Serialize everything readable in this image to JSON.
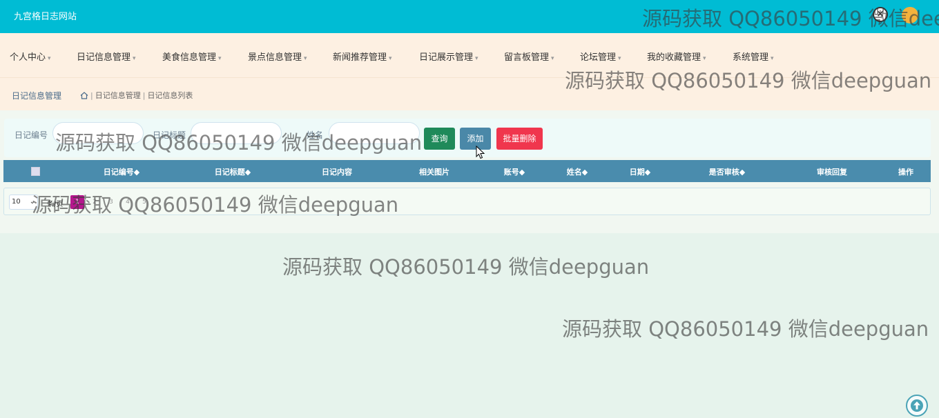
{
  "app": {
    "brand": "九宫格日志网站"
  },
  "nav": {
    "items": [
      {
        "label": "个人中心"
      },
      {
        "label": "日记信息管理"
      },
      {
        "label": "美食信息管理"
      },
      {
        "label": "景点信息管理"
      },
      {
        "label": "新闻推荐管理"
      },
      {
        "label": "日记展示管理"
      },
      {
        "label": "留言板管理"
      },
      {
        "label": "论坛管理"
      },
      {
        "label": "我的收藏管理"
      },
      {
        "label": "系统管理"
      }
    ]
  },
  "breadcrumb": {
    "title": "日记信息管理",
    "items": [
      "日记信息管理",
      "日记信息列表"
    ]
  },
  "search": {
    "fields": [
      {
        "label": "日记编号",
        "value": ""
      },
      {
        "label": "日记标题",
        "value": ""
      },
      {
        "label": "姓名",
        "value": ""
      }
    ],
    "search_label": "查询",
    "add_label": "添加",
    "delete_label": "批量删除"
  },
  "table": {
    "columns": [
      "日记编号◆",
      "日记标题◆",
      "日记内容",
      "相关图片",
      "账号◆",
      "姓名◆",
      "日期◆",
      "是否审核◆",
      "审核回复",
      "操作"
    ]
  },
  "pager": {
    "page_size": "10",
    "per_page_label": "条/页",
    "pages": [
      "1",
      "2",
      "3",
      "4",
      "5"
    ],
    "current_page": 1
  },
  "watermark": {
    "text": "源码获取 QQ86050149 微信deepguan"
  },
  "colors": {
    "topbar": "#00bcd4",
    "nav_bg": "#fdf0e2",
    "table_header": "#4a8cad",
    "search_btn": "#1f8a5a",
    "add_btn": "#4a88a8",
    "delete_btn": "#f0364d",
    "page_active": "#b5178d"
  },
  "icons": [
    "home-icon",
    "close-icon",
    "avatar",
    "arrow-up-icon",
    "cursor-icon"
  ]
}
